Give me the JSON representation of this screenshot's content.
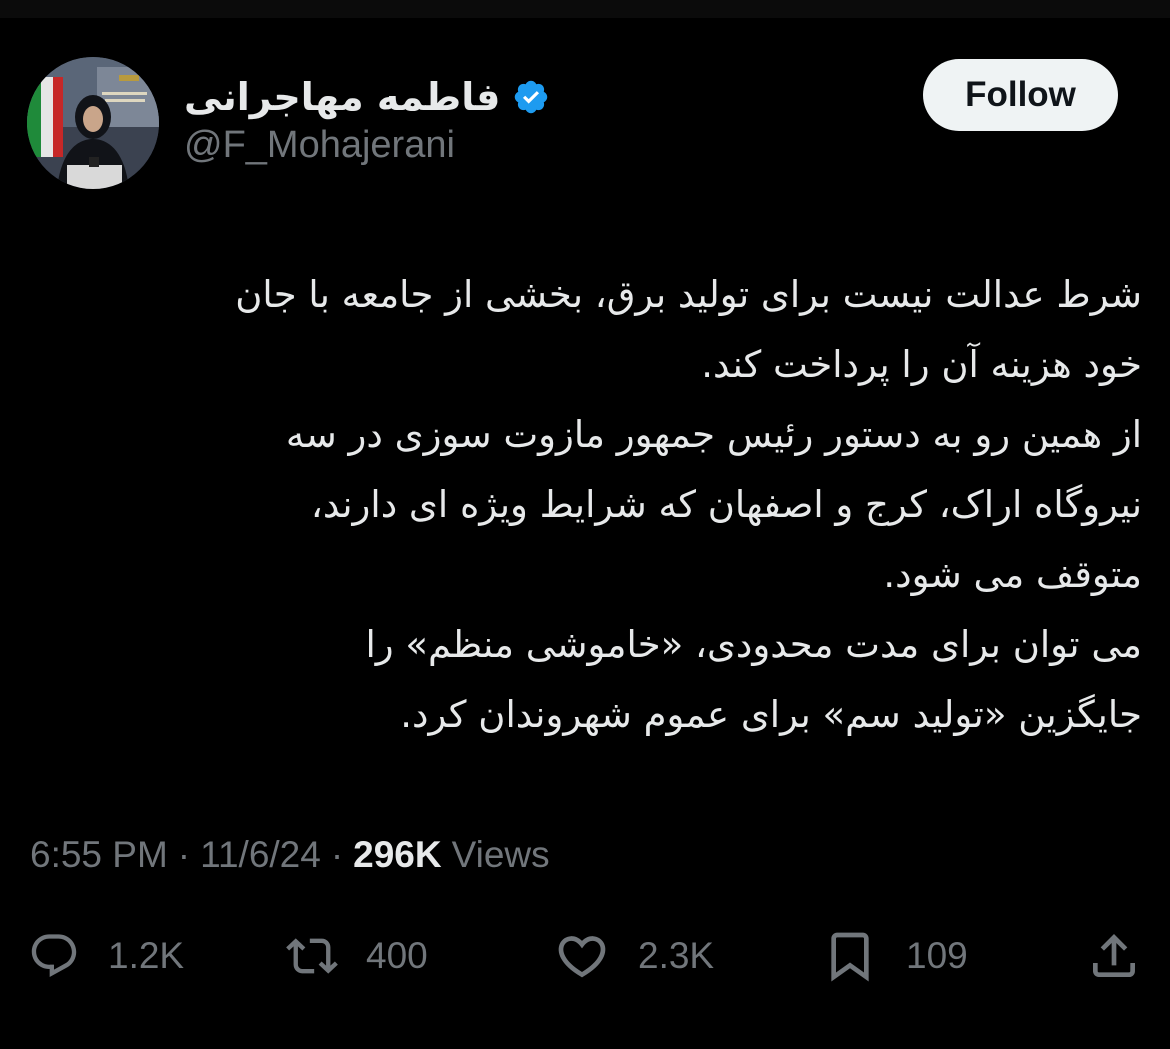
{
  "author": {
    "display_name": "فاطمه مهاجرانی",
    "handle": "@F_Mohajerani",
    "verified": true,
    "avatar_icon": "profile-photo"
  },
  "follow_label": "Follow",
  "tweet": {
    "lines": [
      "شرط عدالت نیست برای تولید برق، بخشی از جامعه با جان",
      "خود هزینه آن را پرداخت کند.",
      "از همین رو به دستور رئیس جمهور مازوت سوزی در سه",
      "نیروگاه اراک، کرج و اصفهان که شرایط ویژه ای دارند،",
      "متوقف می شود.",
      "می توان برای مدت محدودی، «خاموشی منظم» را",
      "جایگزین «تولید سم» برای عموم شهروندان کرد."
    ]
  },
  "meta": {
    "time": "6:55 PM",
    "separator": "·",
    "date": "11/6/24",
    "views_count": "296K",
    "views_label": "Views"
  },
  "actions": {
    "replies": "1.2K",
    "reposts": "400",
    "likes": "2.3K",
    "bookmarks": "109"
  },
  "colors": {
    "background": "#000000",
    "text_primary": "#e7e9ea",
    "text_secondary": "#71767b",
    "verified_blue": "#1d9bf0",
    "follow_bg": "#eff3f4"
  }
}
